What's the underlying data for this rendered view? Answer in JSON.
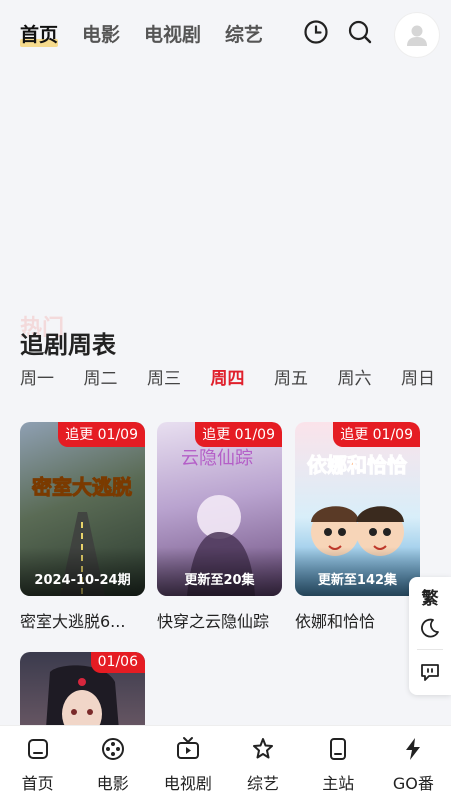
{
  "nav": {
    "tabs": [
      {
        "label": "首页",
        "active": true
      },
      {
        "label": "电影",
        "active": false
      },
      {
        "label": "电视剧",
        "active": false
      },
      {
        "label": "综艺",
        "active": false
      }
    ],
    "icons": [
      "history-icon",
      "search-icon",
      "user-avatar-icon"
    ]
  },
  "ghost_title": "热门",
  "schedule": {
    "title": "追剧周表",
    "days": [
      "周一",
      "周二",
      "周三",
      "周四",
      "周五",
      "周六",
      "周日"
    ],
    "active_day": "周四"
  },
  "cards": [
    {
      "badge": "追更 01/09",
      "overlay": "2024-10-24期",
      "title": "密室大逃脱6...",
      "poster_top": "#6e7f90",
      "poster_bottom": "#2b3a2f"
    },
    {
      "badge": "追更 01/09",
      "overlay": "更新至20集",
      "title": "快穿之云隐仙踪",
      "poster_top": "#d9c9e6",
      "poster_bottom": "#6a4b7c"
    },
    {
      "badge": "追更 01/09",
      "overlay": "更新至142集",
      "title": "依娜和恰恰",
      "poster_top": "#f4c8d2",
      "poster_bottom": "#5aa6d9"
    },
    {
      "badge": "01/06",
      "overlay": "",
      "title": "",
      "poster_top": "#3b3b4d",
      "poster_bottom": "#b86a5d"
    }
  ],
  "float_panel": {
    "traditional_label": "繁",
    "icons": [
      "moon-icon",
      "feedback-icon"
    ]
  },
  "bottom_nav": [
    {
      "label": "首页",
      "icon": "home-icon"
    },
    {
      "label": "电影",
      "icon": "film-reel-icon"
    },
    {
      "label": "电视剧",
      "icon": "tv-icon"
    },
    {
      "label": "综艺",
      "icon": "star-icon"
    },
    {
      "label": "主站",
      "icon": "phone-icon"
    },
    {
      "label": "GO番",
      "icon": "lightning-icon"
    }
  ],
  "colors": {
    "accent": "#e0202c",
    "badge": "#e51c23",
    "background": "#f4f5f8"
  }
}
